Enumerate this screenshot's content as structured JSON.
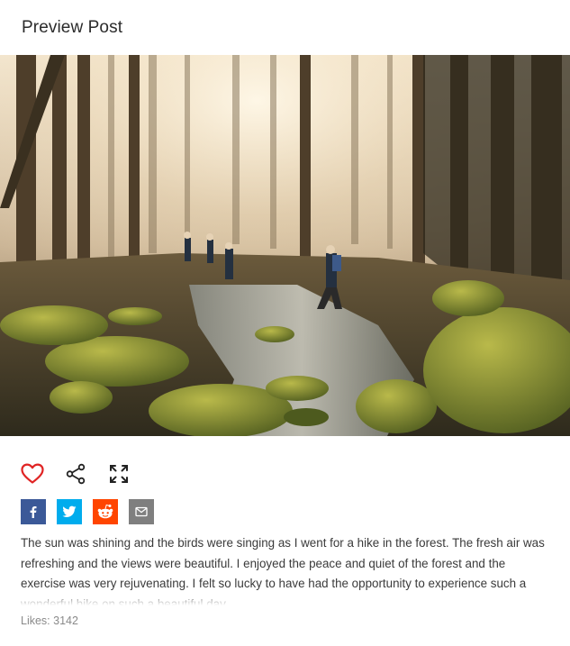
{
  "header": {
    "title": "Preview Post"
  },
  "photo": {
    "alt": "Hikers walking along a mossy forest stream in sunlight"
  },
  "actions": {
    "like_icon": "heart-icon",
    "share_icon": "share-icon",
    "expand_icon": "expand-icon",
    "like_color": "#e02424"
  },
  "share": [
    {
      "name": "facebook",
      "icon": "facebook-icon",
      "color": "#3b5998"
    },
    {
      "name": "twitter",
      "icon": "twitter-icon",
      "color": "#00aced"
    },
    {
      "name": "reddit",
      "icon": "reddit-icon",
      "color": "#ff4500"
    },
    {
      "name": "email",
      "icon": "email-icon",
      "color": "#7f7f7f"
    }
  ],
  "post": {
    "caption": "The sun was shining and the birds were singing as I went for a hike in the forest. The fresh air was refreshing and the views were beautiful. I enjoyed the peace and quiet of the forest and the exercise was very rejuvenating. I felt so lucky to have had the opportunity to experience such a wonderful hike on such a beautiful day.",
    "likes": "Likes: 3142"
  }
}
